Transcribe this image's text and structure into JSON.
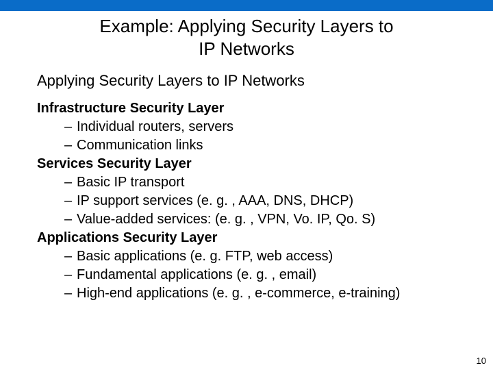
{
  "title_line1": "Example: Applying Security Layers to",
  "title_line2": "IP Networks",
  "subtitle": "Applying Security Layers to IP Networks",
  "sections": [
    {
      "heading": "Infrastructure Security Layer",
      "items": [
        "Individual routers, servers",
        "Communication links"
      ]
    },
    {
      "heading": "Services Security Layer",
      "items": [
        "Basic IP transport",
        "IP support services (e. g. , AAA, DNS, DHCP)",
        "Value-added services: (e. g. , VPN, Vo. IP, Qo. S)"
      ]
    },
    {
      "heading": "Applications Security Layer",
      "items": [
        "Basic applications (e. g. FTP, web access)",
        "Fundamental applications (e. g. , email)",
        "High-end applications (e. g. , e-commerce, e-training)"
      ]
    }
  ],
  "page_number": "10"
}
